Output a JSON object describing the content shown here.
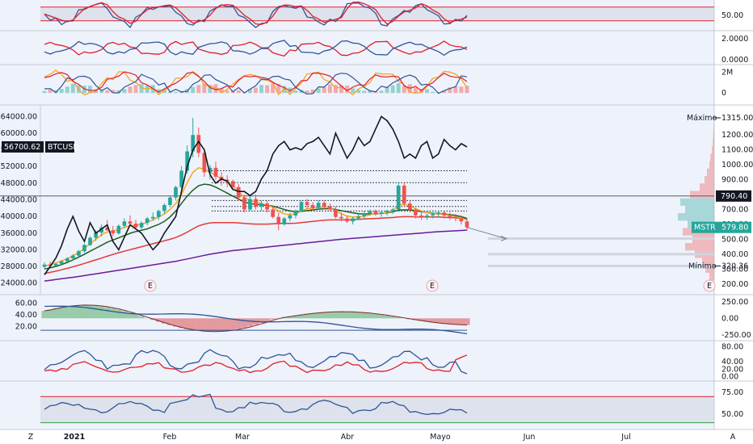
{
  "colors": {
    "background": "#eef2fb",
    "axis_bg": "#ffffff",
    "up": "#26a69a",
    "down": "#ef5350",
    "line_black": "#131722",
    "ma_orange": "#f5a623",
    "ma_green": "#1b5e20",
    "ma_red": "#e53935",
    "ma_purple": "#6a1b9a",
    "osc_blue": "#2f5597",
    "osc_red": "#e01e2b",
    "fill_green": "#2e9c44",
    "fill_red": "#d32f2f",
    "band": "#cfd5e0"
  },
  "chart_data": {
    "type": "candlestick",
    "symbol_left_label": "BTCUSD",
    "left_price_tag": "56700.62",
    "left_axis_ticks": [
      "64000.00",
      "60000.00",
      "56000.00",
      "52000.00",
      "48000.00",
      "44000.00",
      "40000.00",
      "36000.00",
      "32000.00",
      "28000.00",
      "24000.00"
    ],
    "left_axis_values": [
      64000,
      60000,
      56000,
      52000,
      48000,
      44000,
      40000,
      36000,
      32000,
      28000,
      24000
    ],
    "right_axis_ticks": [
      "1200.00",
      "1100.00",
      "1000.00",
      "900.00",
      "800.00",
      "700.00",
      "600.00",
      "500.00",
      "400.00",
      "300.00",
      "200.00"
    ],
    "right_axis_values": [
      1200,
      1100,
      1000,
      900,
      800,
      700,
      600,
      500,
      400,
      300,
      200
    ],
    "right_price_ylim": [
      150,
      1380
    ],
    "left_price_ylim": [
      22000,
      66000
    ],
    "max_label": "Máximo",
    "max_value": 1315,
    "max_value_text": "1315.00",
    "min_label": "Mínimo",
    "min_value": 320.36,
    "min_value_text": "320.36",
    "level_tag_text": "790.40",
    "level_value": 790.4,
    "current_tag_symbol": "MSTR",
    "current_tag_value": "579.80",
    "current_value": 579.8,
    "earnings_marker": "E",
    "x_labels": [
      "2021",
      "Feb",
      "Mar",
      "Abr",
      "Mayo",
      "Jun",
      "Jul"
    ],
    "bottom_corner_left": "Z",
    "bottom_corner_right": "A",
    "candles_ohlc": [
      [
        315,
        345,
        305,
        330
      ],
      [
        330,
        350,
        318,
        322
      ],
      [
        322,
        340,
        312,
        335
      ],
      [
        335,
        360,
        328,
        352
      ],
      [
        352,
        380,
        345,
        372
      ],
      [
        372,
        400,
        360,
        390
      ],
      [
        390,
        430,
        380,
        420
      ],
      [
        420,
        470,
        410,
        462
      ],
      [
        462,
        520,
        455,
        510
      ],
      [
        510,
        560,
        490,
        545
      ],
      [
        545,
        600,
        520,
        580
      ],
      [
        580,
        630,
        560,
        560
      ],
      [
        560,
        590,
        520,
        540
      ],
      [
        540,
        600,
        530,
        590
      ],
      [
        590,
        640,
        575,
        620
      ],
      [
        620,
        660,
        600,
        605
      ],
      [
        605,
        630,
        570,
        580
      ],
      [
        580,
        620,
        560,
        610
      ],
      [
        610,
        650,
        595,
        640
      ],
      [
        640,
        680,
        625,
        650
      ],
      [
        650,
        700,
        630,
        690
      ],
      [
        690,
        740,
        670,
        730
      ],
      [
        730,
        790,
        715,
        780
      ],
      [
        780,
        860,
        760,
        850
      ],
      [
        850,
        990,
        830,
        960
      ],
      [
        960,
        1130,
        940,
        1090
      ],
      [
        1090,
        1315,
        1050,
        1200
      ],
      [
        1200,
        1250,
        1050,
        1080
      ],
      [
        1080,
        1100,
        920,
        950
      ],
      [
        950,
        1000,
        900,
        980
      ],
      [
        980,
        1020,
        900,
        920
      ],
      [
        920,
        950,
        860,
        900
      ],
      [
        900,
        930,
        850,
        890
      ],
      [
        890,
        900,
        830,
        850
      ],
      [
        850,
        870,
        760,
        780
      ],
      [
        780,
        800,
        680,
        700
      ],
      [
        700,
        790,
        690,
        770
      ],
      [
        770,
        800,
        700,
        720
      ],
      [
        720,
        760,
        690,
        740
      ],
      [
        740,
        760,
        680,
        700
      ],
      [
        700,
        720,
        640,
        650
      ],
      [
        650,
        680,
        560,
        600
      ],
      [
        600,
        650,
        590,
        640
      ],
      [
        640,
        680,
        620,
        660
      ],
      [
        660,
        700,
        640,
        690
      ],
      [
        690,
        760,
        680,
        750
      ],
      [
        750,
        770,
        700,
        730
      ],
      [
        730,
        750,
        690,
        710
      ],
      [
        710,
        760,
        700,
        745
      ],
      [
        745,
        760,
        700,
        720
      ],
      [
        720,
        740,
        690,
        700
      ],
      [
        700,
        720,
        640,
        650
      ],
      [
        650,
        680,
        620,
        640
      ],
      [
        640,
        660,
        610,
        620
      ],
      [
        620,
        650,
        600,
        640
      ],
      [
        640,
        670,
        630,
        655
      ],
      [
        655,
        690,
        640,
        675
      ],
      [
        675,
        700,
        660,
        690
      ],
      [
        690,
        700,
        660,
        670
      ],
      [
        670,
        690,
        650,
        680
      ],
      [
        680,
        700,
        660,
        690
      ],
      [
        690,
        710,
        670,
        700
      ],
      [
        700,
        880,
        690,
        860
      ],
      [
        860,
        880,
        720,
        740
      ],
      [
        740,
        760,
        680,
        700
      ],
      [
        700,
        710,
        640,
        660
      ],
      [
        660,
        680,
        630,
        650
      ],
      [
        650,
        670,
        630,
        660
      ],
      [
        660,
        680,
        640,
        670
      ],
      [
        670,
        690,
        650,
        680
      ],
      [
        680,
        690,
        640,
        660
      ],
      [
        660,
        680,
        630,
        650
      ],
      [
        650,
        670,
        620,
        640
      ],
      [
        640,
        660,
        600,
        620
      ],
      [
        620,
        640,
        560,
        580
      ]
    ],
    "btc_line": [
      26000,
      28000,
      30000,
      33000,
      37000,
      40000,
      36500,
      34000,
      38500,
      36000,
      37000,
      38000,
      34000,
      32000,
      35000,
      38000,
      37000,
      36000,
      34000,
      32000,
      33500,
      36000,
      38000,
      40000,
      46000,
      52000,
      56000,
      58000,
      56000,
      50000,
      48000,
      49000,
      48500,
      46500,
      46000,
      46000,
      45000,
      46000,
      49000,
      51000,
      55000,
      57000,
      58000,
      56000,
      56500,
      56000,
      57500,
      58000,
      59000,
      57000,
      55000,
      60000,
      57000,
      54000,
      56000,
      59000,
      57000,
      58000,
      61000,
      64000,
      63000,
      61000,
      58000,
      54000,
      55000,
      54000,
      57000,
      58000,
      54000,
      55000,
      58500,
      57000,
      56000,
      57500,
      56700
    ],
    "ma_fast": [
      320,
      330,
      340,
      355,
      370,
      390,
      410,
      440,
      470,
      500,
      530,
      550,
      555,
      565,
      580,
      590,
      595,
      600,
      615,
      630,
      650,
      670,
      700,
      740,
      800,
      880,
      950,
      980,
      970,
      950,
      930,
      905,
      885,
      860,
      820,
      780,
      760,
      750,
      740,
      730,
      715,
      690,
      670,
      665,
      670,
      690,
      705,
      710,
      715,
      715,
      710,
      690,
      670,
      655,
      650,
      650,
      655,
      665,
      675,
      675,
      680,
      690,
      730,
      735,
      725,
      705,
      690,
      678,
      672,
      670,
      668,
      660,
      652,
      642,
      630
    ],
    "ma_mid": [
      300,
      308,
      318,
      330,
      345,
      362,
      380,
      400,
      420,
      440,
      460,
      480,
      495,
      510,
      525,
      540,
      552,
      560,
      570,
      585,
      600,
      620,
      650,
      690,
      740,
      790,
      830,
      860,
      870,
      865,
      850,
      830,
      810,
      790,
      770,
      750,
      740,
      735,
      730,
      728,
      722,
      712,
      700,
      690,
      685,
      688,
      692,
      698,
      702,
      705,
      705,
      700,
      692,
      685,
      678,
      672,
      670,
      670,
      672,
      674,
      678,
      684,
      695,
      698,
      697,
      692,
      686,
      680,
      675,
      672,
      670,
      665,
      660,
      652,
      640
    ],
    "ma_slow": [
      270,
      278,
      286,
      295,
      305,
      315,
      326,
      338,
      350,
      362,
      374,
      386,
      398,
      410,
      420,
      430,
      440,
      450,
      460,
      470,
      480,
      490,
      500,
      512,
      528,
      548,
      570,
      590,
      602,
      610,
      612,
      612,
      612,
      612,
      610,
      606,
      604,
      602,
      602,
      602,
      604,
      606,
      606,
      606,
      608,
      612,
      616,
      620,
      624,
      628,
      630,
      630,
      630,
      630,
      632,
      634,
      636,
      638,
      640,
      642,
      644,
      646,
      650,
      652,
      652,
      650,
      650,
      650,
      650,
      650,
      648,
      646,
      644,
      640,
      636
    ],
    "ma_long": [
      220,
      225,
      230,
      235,
      240,
      245,
      250,
      256,
      262,
      268,
      274,
      280,
      286,
      292,
      298,
      304,
      310,
      316,
      322,
      328,
      334,
      340,
      346,
      352,
      360,
      368,
      376,
      384,
      392,
      400,
      406,
      412,
      418,
      424,
      428,
      432,
      436,
      440,
      444,
      448,
      452,
      456,
      460,
      464,
      468,
      472,
      476,
      480,
      484,
      488,
      492,
      496,
      500,
      503,
      506,
      509,
      512,
      515,
      518,
      521,
      524,
      527,
      530,
      533,
      536,
      539,
      542,
      545,
      548,
      551,
      553,
      555,
      557,
      559,
      561
    ],
    "dotted_levels": [
      960,
      880,
      760,
      720,
      690
    ],
    "volume_profile_levels": [
      250,
      300,
      350,
      400,
      450,
      500,
      550,
      600,
      650,
      700,
      750,
      800,
      850,
      900,
      950,
      1000,
      1050,
      1100,
      1150,
      1200,
      1250
    ],
    "volume_profile_values": [
      10,
      18,
      25,
      40,
      60,
      45,
      65,
      55,
      75,
      60,
      70,
      50,
      30,
      20,
      15,
      10,
      8,
      5,
      3,
      2,
      1
    ]
  },
  "panes": {
    "stoch_top": {
      "ticks": [
        "50.00"
      ],
      "tick_values": [
        50
      ],
      "ylim": [
        0,
        100
      ],
      "band": [
        30,
        80
      ]
    },
    "macd_ratio": {
      "ticks": [
        "2.0000",
        "0.0000"
      ],
      "tick_values": [
        2,
        0
      ],
      "ylim": [
        -0.3,
        2.6
      ]
    },
    "volume": {
      "ticks": [
        "2M",
        "0"
      ],
      "tick_values": [
        2,
        0
      ],
      "ylim": [
        -1,
        2.6
      ]
    },
    "cmf": {
      "left_ticks": [
        "60.00",
        "40.00",
        "20.00"
      ],
      "left_tick_values": [
        60,
        40,
        20
      ],
      "right_ticks": [
        "250.00",
        "0.00",
        "-250.00"
      ],
      "right_tick_values": [
        250,
        0,
        -250
      ],
      "ylim": [
        -300,
        320
      ]
    },
    "dmi": {
      "ticks": [
        "80.00",
        "40.00",
        "20.00",
        "0.00"
      ],
      "tick_values": [
        80,
        40,
        20,
        0
      ],
      "ylim": [
        -5,
        90
      ]
    },
    "rsi": {
      "ticks": [
        "75.00",
        "50.00"
      ],
      "tick_values": [
        75,
        50
      ],
      "ylim": [
        35,
        85
      ],
      "band": [
        40,
        70
      ]
    }
  }
}
